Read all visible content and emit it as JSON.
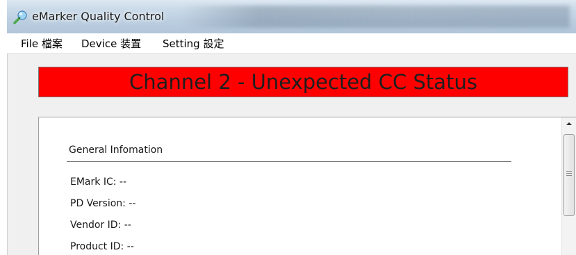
{
  "window": {
    "title": "eMarker Quality Control"
  },
  "menu": {
    "items": [
      {
        "label": "File 檔案"
      },
      {
        "label": "Device 装置"
      },
      {
        "label": "Setting 設定"
      }
    ]
  },
  "status": {
    "message": "Channel 2 - Unexpected CC Status",
    "color": "#ff0000"
  },
  "info": {
    "section_title": "General Infomation",
    "fields": [
      {
        "text": "EMark IC: --"
      },
      {
        "text": "PD Version: --"
      },
      {
        "text": "Vendor ID: --"
      },
      {
        "text": "Product ID: --"
      }
    ]
  },
  "icons": {
    "app": "emarker-app-icon",
    "scroll_up": "chevron-up-icon",
    "thumb_grip": "grip-icon"
  }
}
